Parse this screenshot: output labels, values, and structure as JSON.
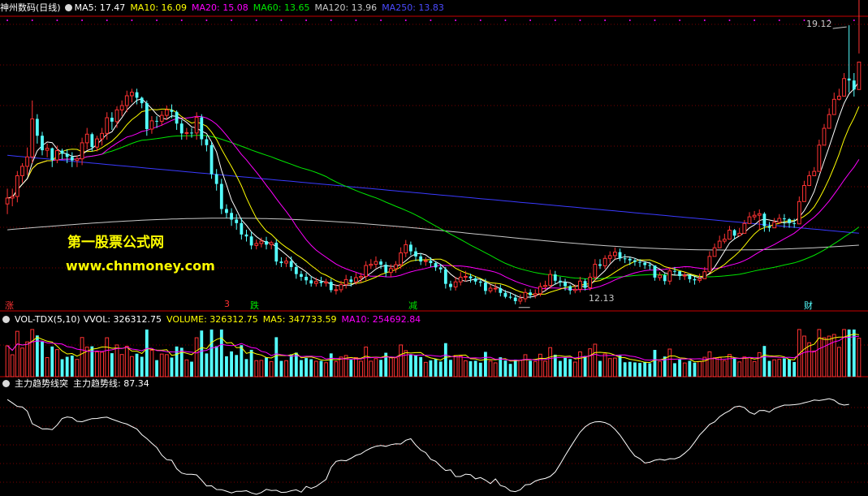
{
  "header": {
    "stock_name": "神州数码(日线)",
    "ma5": "MA5: 17.47",
    "ma10": "MA10: 16.09",
    "ma20": "MA20: 15.08",
    "ma60": "MA60: 13.65",
    "ma120": "MA120: 13.96",
    "ma250": "MA250: 13.83"
  },
  "vol_header": {
    "indicator": "VOL-TDX(5,10)",
    "vvol": "VVOL: 326312.75",
    "volume": "VOLUME: 326312.75",
    "ma5": "MA5: 347733.59",
    "ma10": "MA10: 254692.84"
  },
  "trend_header": {
    "indicator": "主力趋势线突",
    "value": "主力趋势线: 87.34"
  },
  "watermark": {
    "line1": "第一股票公式网",
    "line2": "www.chnmoney.com"
  },
  "annotations": {
    "high": "19.12",
    "low": "12.13",
    "zhang": "涨",
    "die": "跌",
    "jian": "减",
    "cai": "财",
    "tag": "3"
  },
  "colors": {
    "up": "#ff3232",
    "down": "#54ffff",
    "ma5": "#ffffff",
    "ma10": "#ffff00",
    "ma20": "#ff00ff",
    "ma60": "#00e600",
    "ma120": "#c8c8c8",
    "ma250": "#3a3aff",
    "divider": "#c80000",
    "grid": "#7a0000"
  },
  "chart_data": [
    {
      "type": "candlestick",
      "name": "price",
      "y_range_hint": [
        12.13,
        19.12
      ],
      "x": [
        1,
        2,
        3,
        4,
        5,
        6,
        7,
        8,
        9,
        10,
        11,
        12,
        13,
        14,
        15,
        16,
        17,
        18,
        19,
        20,
        21,
        22,
        23,
        24,
        25,
        26,
        27,
        28,
        29,
        30,
        31,
        32,
        33,
        34,
        35,
        36,
        37,
        38,
        39,
        40,
        41,
        42,
        43,
        44,
        45,
        46,
        47,
        48,
        49,
        50,
        51,
        52,
        53,
        54,
        55,
        56,
        57,
        58,
        59,
        60,
        61,
        62,
        63,
        64,
        65,
        66,
        67,
        68,
        69,
        70,
        71,
        72,
        73,
        74,
        75,
        76,
        77,
        78,
        79,
        80,
        81,
        82,
        83,
        84,
        85,
        86,
        87,
        88,
        89,
        90,
        91,
        92,
        93,
        94,
        95,
        96,
        97,
        98,
        99,
        100,
        101,
        102,
        103,
        104,
        105,
        106,
        107,
        108,
        109,
        110,
        111,
        112,
        113,
        114,
        115,
        116,
        117,
        118,
        119,
        120,
        121,
        122,
        123,
        124,
        125,
        126,
        127,
        128,
        129,
        130,
        131,
        132,
        133,
        134,
        135,
        136,
        137,
        138,
        139,
        140,
        141,
        142,
        143,
        144,
        145,
        146,
        147,
        148,
        149,
        150,
        151,
        152,
        153,
        154,
        155,
        156,
        157,
        158,
        159,
        160,
        161,
        162,
        163,
        164,
        165,
        166,
        167,
        168,
        169,
        170,
        171,
        172,
        173,
        174,
        175,
        176
      ],
      "open": [
        14.56,
        14.71,
        14.75,
        15.28,
        15.52,
        15.76,
        16.73,
        16.3,
        15.93,
        15.98,
        15.68,
        15.92,
        15.84,
        15.76,
        15.67,
        15.71,
        16.12,
        16.34,
        16.01,
        16.22,
        16.36,
        16.76,
        16.66,
        16.96,
        17.07,
        17.32,
        17.41,
        17.27,
        17.13,
        16.47,
        16.68,
        16.67,
        16.82,
        16.96,
        16.91,
        16.61,
        16.36,
        16.38,
        16.37,
        16.77,
        16.21,
        16.06,
        15.32,
        15.07,
        14.43,
        14.33,
        14.16,
        14.07,
        13.78,
        13.73,
        13.5,
        13.55,
        13.61,
        13.52,
        13.57,
        13.09,
        13.05,
        13.1,
        12.95,
        12.77,
        12.7,
        12.61,
        12.53,
        12.58,
        12.54,
        12.57,
        12.36,
        12.37,
        12.5,
        12.63,
        12.57,
        12.68,
        12.71,
        12.99,
        13.02,
        13.09,
        13.01,
        12.81,
        12.91,
        13.01,
        13.31,
        13.52,
        13.35,
        13.22,
        13.09,
        13.11,
        13.05,
        12.94,
        12.89,
        12.52,
        12.44,
        12.57,
        12.69,
        12.71,
        12.66,
        12.58,
        12.55,
        12.34,
        12.41,
        12.41,
        12.29,
        12.19,
        12.17,
        12.08,
        12.14,
        12.3,
        12.23,
        12.27,
        12.45,
        12.48,
        12.76,
        12.6,
        12.56,
        12.46,
        12.35,
        12.38,
        12.59,
        12.42,
        12.69,
        13.02,
        12.98,
        13.17,
        13.24,
        13.33,
        13.17,
        13.16,
        13.12,
        13.08,
        13.06,
        13.0,
        12.99,
        12.68,
        12.74,
        12.59,
        12.85,
        12.84,
        12.72,
        12.74,
        12.64,
        12.61,
        12.65,
        12.83,
        13.22,
        13.44,
        13.61,
        13.66,
        13.89,
        13.75,
        13.81,
        14.06,
        14.23,
        14.27,
        14.31,
        13.99,
        13.95,
        14.09,
        14.19,
        14.17,
        14.07,
        14.05,
        14.62,
        15.03,
        15.28,
        15.39,
        16.06,
        16.49,
        16.84,
        17.23,
        17.31,
        17.76,
        17.71,
        17.48
      ],
      "close": [
        14.71,
        14.75,
        15.28,
        15.52,
        15.76,
        16.73,
        16.3,
        15.93,
        15.98,
        15.68,
        15.92,
        15.84,
        15.76,
        15.67,
        15.71,
        16.12,
        16.34,
        16.01,
        16.22,
        16.36,
        16.76,
        16.66,
        16.96,
        17.07,
        17.32,
        17.41,
        17.27,
        17.13,
        16.47,
        16.68,
        16.67,
        16.82,
        16.96,
        16.91,
        16.61,
        16.36,
        16.38,
        16.37,
        16.77,
        16.21,
        16.06,
        15.32,
        15.07,
        14.43,
        14.33,
        14.16,
        14.07,
        13.78,
        13.73,
        13.5,
        13.55,
        13.61,
        13.52,
        13.57,
        13.09,
        13.05,
        13.1,
        12.95,
        12.77,
        12.7,
        12.61,
        12.53,
        12.58,
        12.54,
        12.57,
        12.36,
        12.37,
        12.5,
        12.63,
        12.57,
        12.68,
        12.71,
        12.99,
        13.02,
        13.09,
        13.01,
        12.81,
        12.91,
        13.01,
        13.31,
        13.52,
        13.35,
        13.22,
        13.09,
        13.11,
        13.05,
        12.94,
        12.89,
        12.52,
        12.44,
        12.57,
        12.69,
        12.71,
        12.66,
        12.58,
        12.55,
        12.34,
        12.41,
        12.41,
        12.29,
        12.19,
        12.17,
        12.08,
        12.14,
        12.3,
        12.23,
        12.27,
        12.45,
        12.48,
        12.76,
        12.6,
        12.56,
        12.46,
        12.35,
        12.38,
        12.59,
        12.42,
        12.69,
        13.02,
        12.98,
        13.17,
        13.24,
        13.33,
        13.17,
        13.16,
        13.12,
        13.08,
        13.06,
        13.0,
        12.99,
        12.68,
        12.74,
        12.59,
        12.85,
        12.84,
        12.72,
        12.74,
        12.64,
        12.61,
        12.65,
        12.83,
        13.22,
        13.44,
        13.61,
        13.66,
        13.89,
        13.75,
        13.81,
        14.06,
        14.23,
        14.27,
        14.31,
        13.99,
        13.95,
        14.09,
        14.19,
        14.17,
        14.07,
        14.05,
        14.62,
        15.03,
        15.28,
        15.39,
        16.06,
        16.49,
        16.84,
        17.23,
        17.31,
        17.76,
        17.71,
        17.48,
        18.18
      ],
      "high": [
        14.95,
        14.95,
        15.4,
        15.6,
        16.0,
        17.2,
        16.85,
        16.4,
        16.1,
        16.0,
        16.05,
        15.97,
        15.95,
        15.88,
        15.8,
        16.25,
        16.5,
        16.38,
        16.3,
        16.5,
        16.9,
        16.9,
        17.05,
        17.2,
        17.45,
        17.5,
        17.5,
        17.3,
        17.2,
        16.8,
        16.8,
        16.93,
        17.07,
        17.1,
        16.95,
        16.7,
        16.5,
        16.5,
        16.9,
        16.85,
        16.3,
        16.15,
        15.45,
        15.2,
        14.55,
        14.45,
        14.3,
        14.2,
        13.9,
        13.85,
        13.65,
        13.7,
        13.72,
        13.62,
        13.65,
        13.2,
        13.2,
        13.22,
        13.05,
        12.85,
        12.8,
        12.72,
        12.68,
        12.7,
        12.65,
        12.65,
        12.5,
        12.6,
        12.75,
        12.72,
        12.8,
        12.8,
        13.1,
        13.15,
        13.22,
        13.15,
        13.08,
        13.02,
        13.1,
        13.45,
        13.64,
        13.6,
        13.45,
        13.3,
        13.2,
        13.2,
        13.1,
        13.02,
        12.95,
        12.6,
        12.7,
        12.82,
        12.85,
        12.78,
        12.72,
        12.65,
        12.65,
        12.5,
        12.52,
        12.5,
        12.36,
        12.3,
        12.25,
        12.25,
        12.4,
        12.38,
        12.38,
        12.55,
        12.6,
        12.88,
        12.85,
        12.7,
        12.65,
        12.5,
        12.5,
        12.7,
        12.65,
        12.8,
        13.15,
        13.15,
        13.25,
        13.35,
        13.45,
        13.42,
        13.28,
        13.22,
        13.18,
        13.15,
        13.1,
        13.08,
        12.98,
        12.82,
        12.8,
        12.95,
        12.95,
        12.85,
        12.82,
        12.75,
        12.7,
        12.78,
        12.95,
        13.35,
        13.55,
        13.75,
        13.8,
        14.0,
        13.92,
        13.95,
        14.15,
        14.35,
        14.38,
        14.42,
        14.35,
        14.1,
        14.2,
        14.3,
        14.3,
        14.2,
        14.18,
        14.75,
        15.15,
        15.4,
        15.5,
        16.2,
        16.6,
        17.0,
        17.4,
        17.5,
        17.9,
        19.12,
        17.9,
        18.4
      ],
      "low": [
        14.3,
        14.5,
        14.6,
        15.1,
        15.3,
        15.6,
        16.1,
        15.8,
        15.75,
        15.5,
        15.6,
        15.7,
        15.6,
        15.5,
        15.5,
        15.55,
        15.95,
        15.9,
        15.9,
        16.05,
        16.2,
        16.45,
        16.5,
        16.8,
        16.9,
        17.15,
        17.1,
        17.0,
        16.3,
        16.35,
        16.5,
        16.55,
        16.7,
        16.75,
        16.45,
        16.2,
        16.2,
        16.25,
        16.2,
        16.05,
        15.9,
        15.2,
        14.9,
        14.3,
        14.2,
        14.0,
        13.9,
        13.65,
        13.6,
        13.4,
        13.4,
        13.45,
        13.4,
        13.4,
        13.0,
        12.95,
        12.95,
        12.85,
        12.65,
        12.6,
        12.5,
        12.45,
        12.45,
        12.45,
        12.45,
        12.3,
        12.25,
        12.3,
        12.4,
        12.45,
        12.5,
        12.55,
        12.6,
        12.9,
        12.92,
        12.9,
        12.7,
        12.7,
        12.8,
        12.9,
        13.2,
        13.25,
        13.1,
        13.0,
        12.98,
        12.95,
        12.85,
        12.8,
        12.4,
        12.35,
        12.35,
        12.48,
        12.58,
        12.55,
        12.5,
        12.45,
        12.25,
        12.28,
        12.3,
        12.2,
        12.15,
        12.13,
        12.0,
        12.0,
        12.05,
        12.15,
        12.15,
        12.2,
        12.35,
        12.4,
        12.5,
        12.45,
        12.35,
        12.25,
        12.28,
        12.3,
        12.35,
        12.35,
        12.6,
        12.9,
        12.9,
        13.05,
        13.15,
        13.1,
        13.05,
        13.0,
        12.98,
        12.95,
        12.9,
        12.88,
        12.6,
        12.6,
        12.5,
        12.5,
        12.75,
        12.62,
        12.62,
        12.55,
        12.5,
        12.55,
        12.7,
        13.1,
        13.35,
        13.5,
        13.55,
        13.7,
        13.65,
        13.75,
        13.95,
        14.1,
        14.15,
        13.9,
        13.85,
        13.85,
        14.0,
        14.05,
        13.95,
        13.95,
        13.95,
        14.5,
        14.9,
        15.15,
        15.3,
        15.95,
        16.4,
        16.7,
        17.1,
        17.2,
        17.4,
        17.4,
        17.3
      ]
    },
    {
      "type": "bar",
      "name": "volume",
      "ylabel": "VOLUME",
      "values": [
        150000,
        150000,
        150000,
        150000,
        150000,
        150000,
        150000,
        150000,
        150000,
        150000,
        150000,
        150000,
        150000,
        150000,
        150000,
        150000,
        150000,
        150000,
        150000,
        150000,
        150000,
        150000,
        150000,
        150000,
        150000,
        150000,
        150000,
        150000,
        150000,
        150000,
        150000,
        150000,
        150000,
        150000,
        150000,
        150000,
        150000,
        150000,
        150000,
        150000,
        150000,
        150000,
        150000,
        150000,
        150000,
        150000,
        150000,
        150000,
        150000,
        150000,
        150000,
        150000,
        150000,
        150000,
        150000,
        150000,
        150000,
        150000,
        150000,
        150000,
        150000,
        150000,
        150000,
        150000,
        150000,
        150000,
        150000,
        150000,
        150000,
        150000,
        150000,
        150000,
        150000,
        150000,
        150000,
        150000,
        150000,
        150000,
        150000,
        150000,
        150000,
        150000,
        150000,
        150000,
        150000,
        150000,
        150000,
        150000,
        150000,
        150000,
        150000,
        150000,
        150000,
        150000,
        150000,
        150000,
        150000,
        150000,
        150000,
        150000,
        150000,
        150000,
        150000,
        150000,
        150000,
        150000,
        150000,
        150000,
        150000,
        150000,
        150000,
        150000,
        150000,
        150000,
        150000,
        150000,
        150000,
        150000,
        150000,
        150000,
        150000,
        150000,
        150000,
        150000,
        150000,
        150000,
        150000,
        150000,
        150000,
        150000,
        150000,
        150000,
        150000,
        150000,
        150000,
        150000,
        150000,
        150000,
        150000,
        150000,
        150000,
        150000,
        150000,
        150000,
        150000,
        150000,
        150000,
        150000,
        150000,
        150000,
        150000,
        150000,
        150000,
        150000,
        150000,
        150000,
        150000,
        150000,
        150000,
        150000,
        150000,
        150000,
        150000,
        150000,
        150000,
        150000,
        150000,
        150000,
        150000,
        150000,
        150000,
        150000,
        150000,
        150000,
        150000,
        326312.75
      ]
    },
    {
      "type": "line",
      "name": "主力趋势线",
      "y_range_hint": [
        0,
        100
      ],
      "values": [
        91.97,
        88.72,
        85.36,
        84.71,
        80.68,
        68.59,
        66.08,
        63.45,
        63.62,
        62.8,
        67.26,
        73.66,
        75.15,
        74.38,
        70.87,
        70.49,
        72.04,
        73.44,
        73.65,
        74.5,
        74.87,
        72.9,
        71.29,
        69.51,
        68.21,
        65.72,
        63.43,
        57.86,
        54.2,
        49.57,
        45.4,
        38.1,
        33.71,
        33.1,
        24.92,
        20.72,
        19.42,
        19.45,
        18.9,
        13.87,
        8.22,
        8.33,
        4.7,
        4.58,
        3.09,
        1.43,
        3.03,
        2.99,
        3.58,
        1.42,
        0.05,
        1.85,
        4.92,
        3.75,
        4.0,
        1.92,
        2.16,
        3.55,
        4.38,
        2.16,
        7.71,
        5.81,
        7.74,
        11.14,
        14.57,
        26.32,
        32.07,
        33.04,
        32.63,
        35.06,
        37.86,
        39.32,
        42.49,
        44.87,
        46.72,
        47.38,
        46.59,
        48.2,
        49.01,
        48.84,
        52.5,
        53.9,
        47.89,
        43.01,
        40.46,
        34.09,
        32.05,
        27.23,
        23.14,
        23.78,
        17.35,
        17.29,
        19.63,
        19.14,
        15.04,
        16.31,
        13.78,
        10.51,
        14.95,
        8.64,
        7.14,
        3.27,
        2.68,
        4.47,
        9.28,
        9.73,
        12.94,
        14.56,
        15.44,
        17.4,
        21.73,
        29.4,
        37.62,
        45.49,
        53.07,
        60.34,
        65.43,
        68.74,
        70.3,
        70.59,
        69.6,
        67.51,
        63.16,
        57.54,
        50.62,
        43.32,
        37.26,
        34.66,
        30.39,
        31.17,
        33.13,
        34.06,
        33.25,
        34.63,
        34.49,
        36.19,
        40.0,
        44.3,
        50.62,
        57.67,
        62.63,
        67.87,
        70.33,
        75.28,
        78.6,
        81.15,
        84.76,
        85.57,
        84.07,
        79.72,
        77.74,
        81.37,
        81.45,
        79.81,
        83.19,
        85.06,
        86.65,
        86.6,
        87.03,
        87.58,
        88.87,
        89.99,
        91.47,
        91.04,
        91.85,
        92.84,
        91.32,
        87.85,
        86.6,
        87.34
      ]
    }
  ]
}
